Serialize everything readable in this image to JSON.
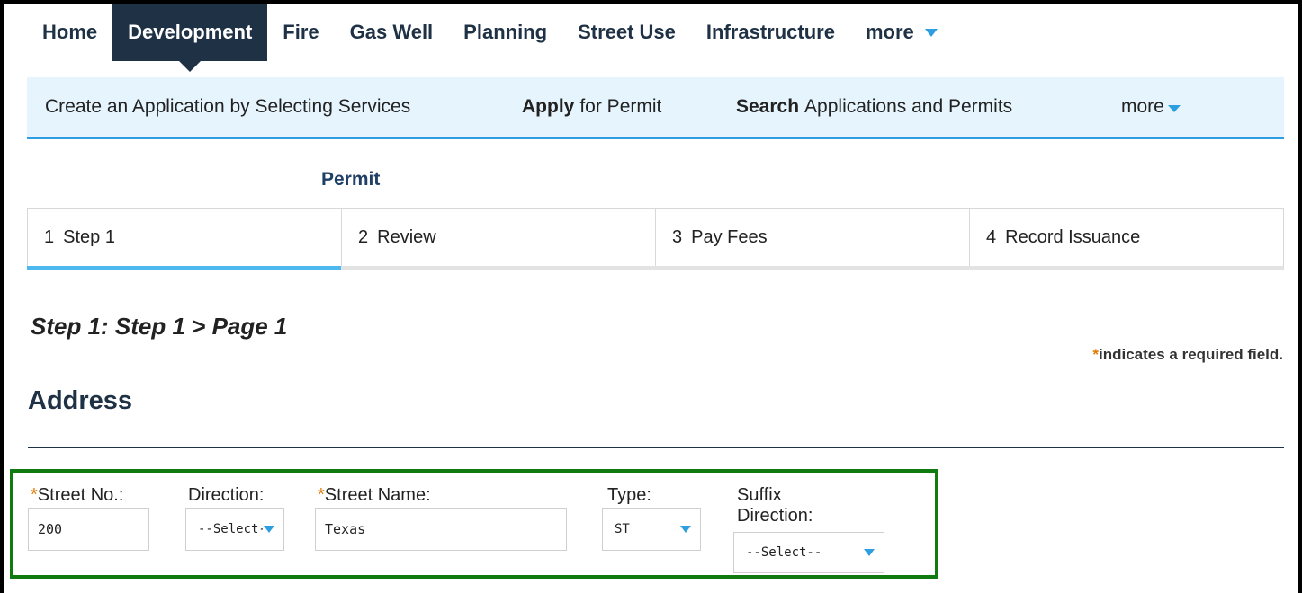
{
  "topnav": {
    "items": [
      {
        "label": "Home"
      },
      {
        "label": "Development"
      },
      {
        "label": "Fire"
      },
      {
        "label": "Gas Well"
      },
      {
        "label": "Planning"
      },
      {
        "label": "Street Use"
      },
      {
        "label": "Infrastructure"
      },
      {
        "label": "more"
      }
    ],
    "active": "Development"
  },
  "subnav": {
    "create": "Create an Application by Selecting Services",
    "apply_bold": "Apply",
    "apply_rest": "for Permit",
    "search_bold": "Search",
    "search_rest": "Applications and Permits",
    "more": "more"
  },
  "permit": {
    "title": "Permit"
  },
  "steps": [
    {
      "num": "1",
      "label": "Step 1"
    },
    {
      "num": "2",
      "label": "Review"
    },
    {
      "num": "3",
      "label": "Pay Fees"
    },
    {
      "num": "4",
      "label": "Record Issuance"
    }
  ],
  "step_heading": "Step 1: Step 1 > Page 1",
  "required_note": {
    "star": "*",
    "text": "indicates a required field."
  },
  "address": {
    "title": "Address",
    "street_no": {
      "label": "Street No.:",
      "required": "*",
      "value": "200"
    },
    "direction": {
      "label": "Direction:",
      "value": "--Select--"
    },
    "street_name": {
      "label": "Street Name:",
      "required": "*",
      "value": "Texas"
    },
    "type": {
      "label": "Type:",
      "value": "ST"
    },
    "suffix_direction": {
      "label_line1": "Suffix",
      "label_line2": "Direction:",
      "value": "--Select--"
    }
  },
  "colors": {
    "nav_dark": "#1f3145",
    "accent_blue": "#2d9fe0",
    "subnav_bg": "#e6f4fd",
    "required_star": "#e07b00",
    "highlight_green": "#0f7a0f"
  }
}
